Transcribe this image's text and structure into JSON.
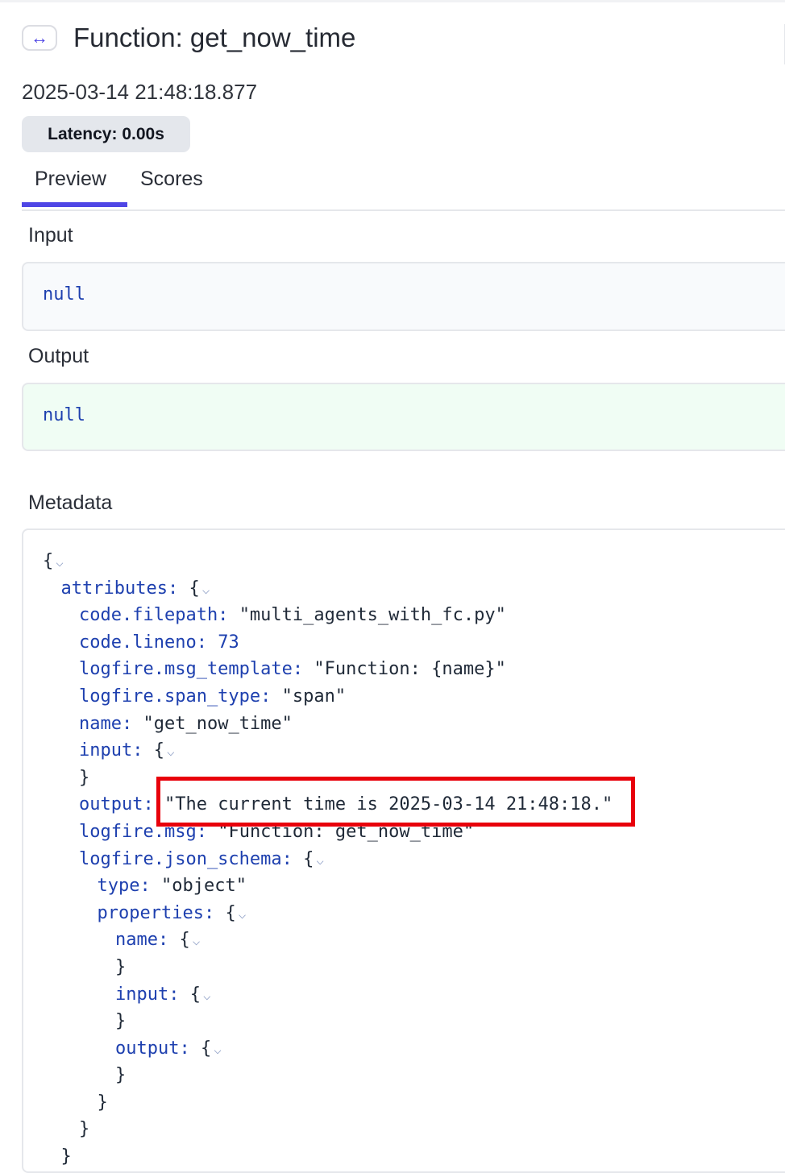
{
  "header": {
    "icon": "arrows-horizontal-icon",
    "title": "Function: get_now_time"
  },
  "timestamp": "2025-03-14 21:48:18.877",
  "latency_badge": "Latency: 0.00s",
  "tabs": [
    {
      "label": "Preview",
      "active": true
    },
    {
      "label": "Scores",
      "active": false
    }
  ],
  "input": {
    "label": "Input",
    "value": "null"
  },
  "output": {
    "label": "Output",
    "value": "null"
  },
  "metadata": {
    "label": "Metadata",
    "lines": [
      {
        "indent": 0,
        "key": "",
        "open": "{",
        "collapsible": true
      },
      {
        "indent": 1,
        "key": "attributes:",
        "open": "{",
        "collapsible": true
      },
      {
        "indent": 2,
        "key": "code.filepath:",
        "value": "\"multi_agents_with_fc.py\""
      },
      {
        "indent": 2,
        "key": "code.lineno:",
        "value": "73",
        "value_is_number": true
      },
      {
        "indent": 2,
        "key": "logfire.msg_template:",
        "value": "\"Function: {name}\""
      },
      {
        "indent": 2,
        "key": "logfire.span_type:",
        "value": "\"span\""
      },
      {
        "indent": 2,
        "key": "name:",
        "value": "\"get_now_time\""
      },
      {
        "indent": 2,
        "key": "input:",
        "open": "{",
        "collapsible": true
      },
      {
        "indent": 2,
        "key": "",
        "close": "}"
      },
      {
        "indent": 2,
        "key": "output:",
        "value": "\"The current time is 2025-03-14 21:48:18.\""
      },
      {
        "indent": 2,
        "key": "logfire.msg:",
        "value": "\"Function: get_now_time\""
      },
      {
        "indent": 2,
        "key": "logfire.json_schema:",
        "open": "{",
        "collapsible": true
      },
      {
        "indent": 3,
        "key": "type:",
        "value": "\"object\""
      },
      {
        "indent": 3,
        "key": "properties:",
        "open": "{",
        "collapsible": true
      },
      {
        "indent": 4,
        "key": "name:",
        "open": "{",
        "collapsible": true
      },
      {
        "indent": 4,
        "key": "",
        "close": "}"
      },
      {
        "indent": 4,
        "key": "input:",
        "open": "{",
        "collapsible": true
      },
      {
        "indent": 4,
        "key": "",
        "close": "}"
      },
      {
        "indent": 4,
        "key": "output:",
        "open": "{",
        "collapsible": true
      },
      {
        "indent": 4,
        "key": "",
        "close": "}"
      },
      {
        "indent": 3,
        "key": "",
        "close": "}"
      },
      {
        "indent": 2,
        "key": "",
        "close": "}"
      },
      {
        "indent": 1,
        "key": "",
        "close": "}"
      }
    ]
  },
  "colors": {
    "accent": "#4f46e5",
    "json_key": "#1e40af",
    "highlight_box": "#e8000b",
    "output_bg": "#f0fdf4"
  }
}
